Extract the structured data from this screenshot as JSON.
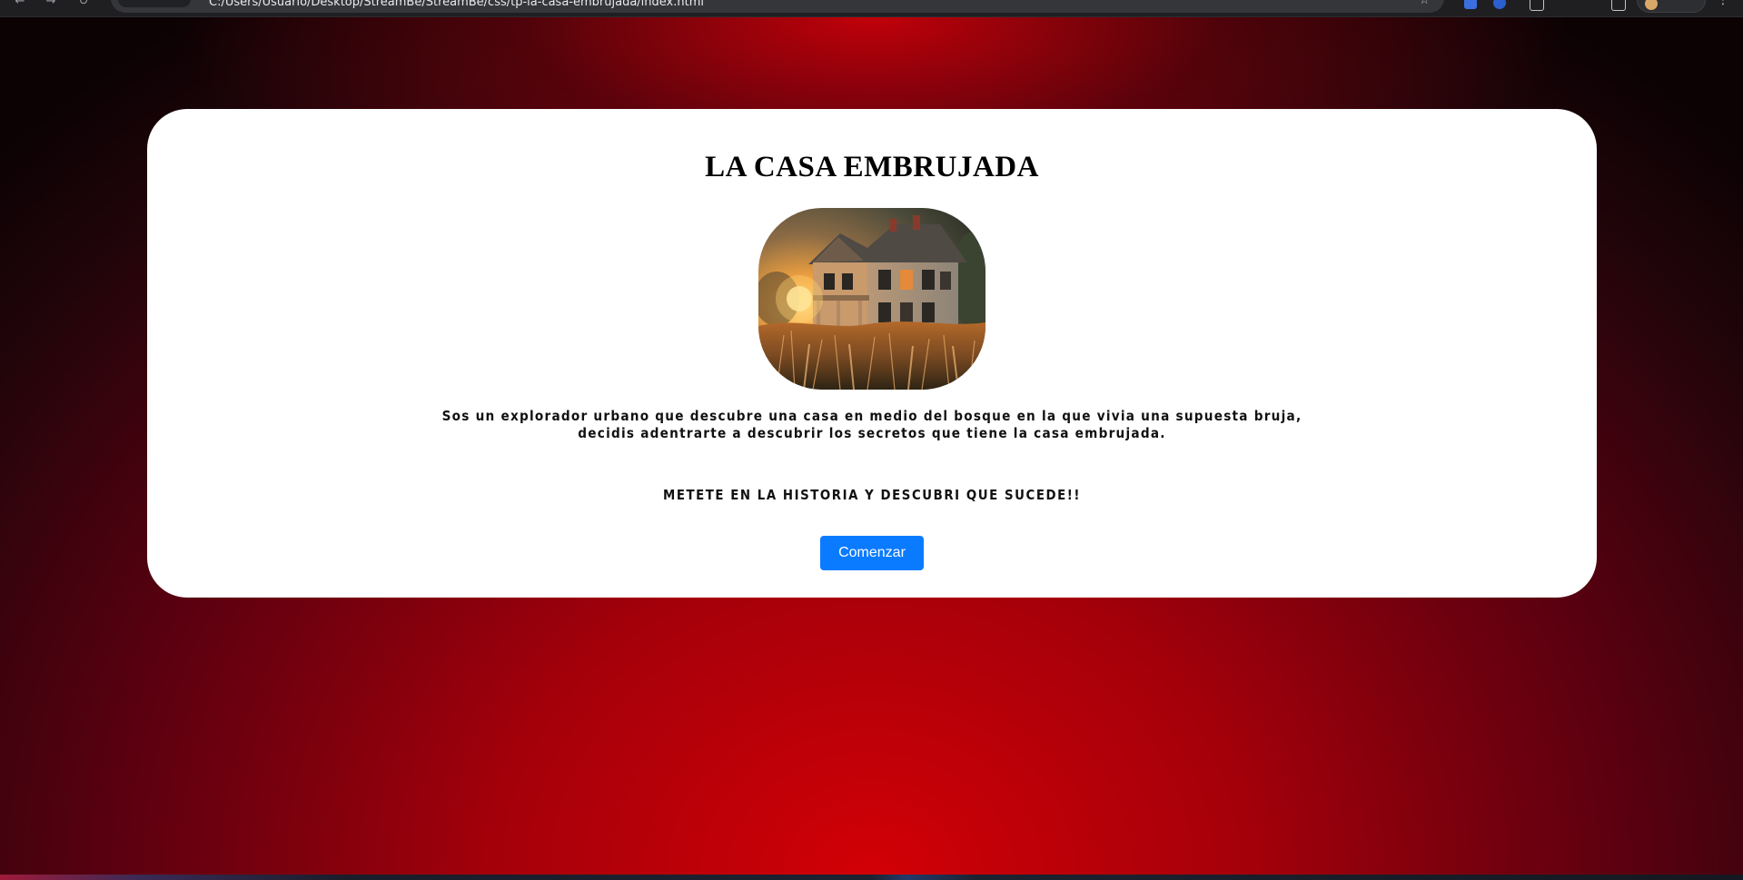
{
  "browser": {
    "url": "C:/Users/Usuario/Desktop/StreamBe/StreamBe/css/tp-la-casa-embrujada/index.html",
    "icons": [
      "back-icon",
      "forward-icon",
      "reload-icon",
      "star-icon",
      "menu-icon"
    ]
  },
  "card": {
    "title": "LA CASA EMBRUJADA",
    "image_alt": "Casa abandonada al atardecer",
    "description": "Sos un explorador urbano que descubre una casa en medio del bosque en la que vivia una supuesta bruja, decidis adentrarte a descubrir los secretos que tiene la casa embrujada.",
    "cta": "METETE EN LA HISTORIA Y DESCUBRI QUE SUCEDE!!",
    "start_button": "Comenzar"
  },
  "colors": {
    "background_center": "#d20006",
    "background_edge": "#0c0204",
    "card": "#ffffff",
    "button": "#0a7bff"
  }
}
